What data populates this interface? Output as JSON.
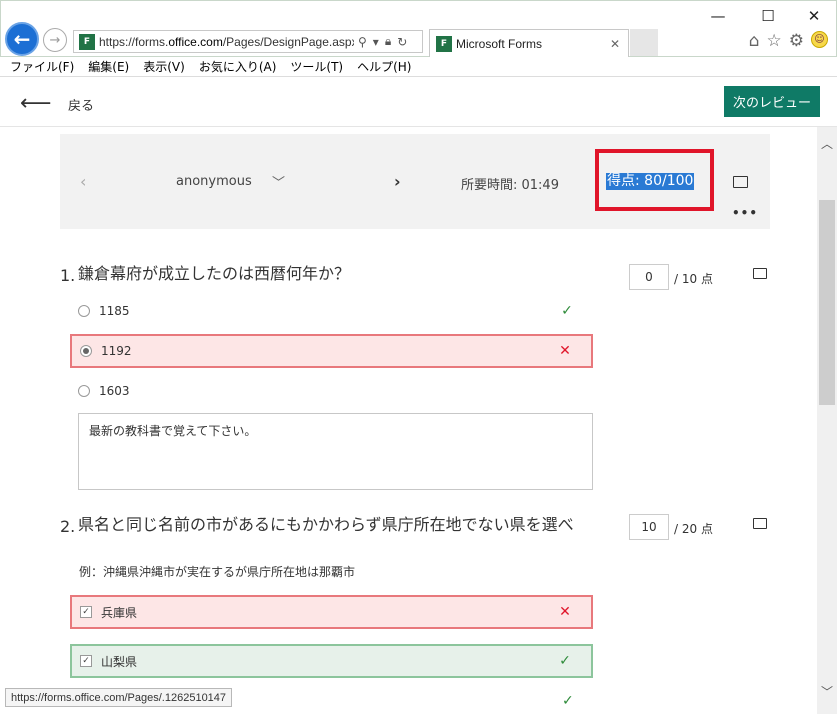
{
  "browser": {
    "url_prefix": "https://forms.",
    "url_domain": "office.com",
    "url_suffix": "/Pages/DesignPage.aspx",
    "tab_title": "Microsoft Forms",
    "favicon_text": "F",
    "minimize": "—",
    "maximize": "☐",
    "close": "✕"
  },
  "menu": [
    "ファイル(F)",
    "編集(E)",
    "表示(V)",
    "お気に入り(A)",
    "ツール(T)",
    "ヘルプ(H)"
  ],
  "header": {
    "back_label": "戻る",
    "next_review": "次のレビュー"
  },
  "response": {
    "respondent": "anonymous",
    "elapsed": "所要時間: 01:49",
    "score": "得点: 80/100"
  },
  "questions": [
    {
      "number": "1.",
      "title": "鎌倉幕府が成立したのは西暦何年か？",
      "score_value": "0",
      "score_max": "/ 10 点",
      "options": [
        {
          "label": "1185",
          "mark": "✓"
        },
        {
          "label": "1192",
          "mark": "✕"
        },
        {
          "label": "1603",
          "mark": ""
        }
      ],
      "feedback": "最新の教科書で覚えて下さい。"
    },
    {
      "number": "2.",
      "title": "県名と同じ名前の市があるにもかかわらず県庁所在地でない県を選べ",
      "subtitle": "例：沖縄県沖縄市が実在するが県庁所在地は那覇市",
      "score_value": "10",
      "score_max": "/ 20 点",
      "options": [
        {
          "label": "兵庫県",
          "mark": "✕"
        },
        {
          "label": "山梨県",
          "mark": "✓"
        },
        {
          "label": "",
          "mark": "✓"
        }
      ]
    }
  ],
  "status_url": "https://forms.office.com/Pages/.1262510147",
  "colors": {
    "accent": "#0f7a66",
    "highlight_box": "#e0152a",
    "wrong_bg": "#fde6e6",
    "right_bg": "#e7f1ea"
  }
}
